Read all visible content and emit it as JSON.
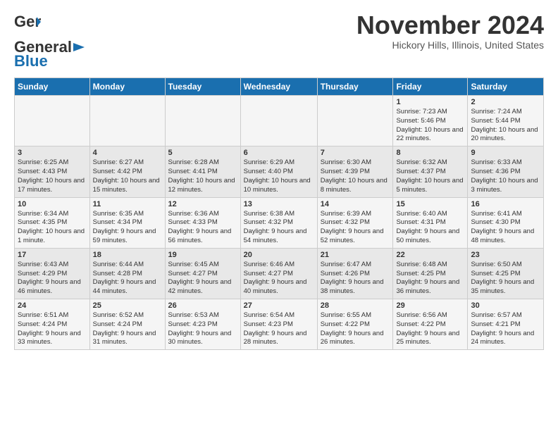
{
  "header": {
    "logo_general": "General",
    "logo_blue": "Blue",
    "month_title": "November 2024",
    "location": "Hickory Hills, Illinois, United States"
  },
  "days_of_week": [
    "Sunday",
    "Monday",
    "Tuesday",
    "Wednesday",
    "Thursday",
    "Friday",
    "Saturday"
  ],
  "weeks": [
    [
      {
        "day": "",
        "info": ""
      },
      {
        "day": "",
        "info": ""
      },
      {
        "day": "",
        "info": ""
      },
      {
        "day": "",
        "info": ""
      },
      {
        "day": "",
        "info": ""
      },
      {
        "day": "1",
        "info": "Sunrise: 7:23 AM\nSunset: 5:46 PM\nDaylight: 10 hours and 22 minutes."
      },
      {
        "day": "2",
        "info": "Sunrise: 7:24 AM\nSunset: 5:44 PM\nDaylight: 10 hours and 20 minutes."
      }
    ],
    [
      {
        "day": "3",
        "info": "Sunrise: 6:25 AM\nSunset: 4:43 PM\nDaylight: 10 hours and 17 minutes."
      },
      {
        "day": "4",
        "info": "Sunrise: 6:27 AM\nSunset: 4:42 PM\nDaylight: 10 hours and 15 minutes."
      },
      {
        "day": "5",
        "info": "Sunrise: 6:28 AM\nSunset: 4:41 PM\nDaylight: 10 hours and 12 minutes."
      },
      {
        "day": "6",
        "info": "Sunrise: 6:29 AM\nSunset: 4:40 PM\nDaylight: 10 hours and 10 minutes."
      },
      {
        "day": "7",
        "info": "Sunrise: 6:30 AM\nSunset: 4:39 PM\nDaylight: 10 hours and 8 minutes."
      },
      {
        "day": "8",
        "info": "Sunrise: 6:32 AM\nSunset: 4:37 PM\nDaylight: 10 hours and 5 minutes."
      },
      {
        "day": "9",
        "info": "Sunrise: 6:33 AM\nSunset: 4:36 PM\nDaylight: 10 hours and 3 minutes."
      }
    ],
    [
      {
        "day": "10",
        "info": "Sunrise: 6:34 AM\nSunset: 4:35 PM\nDaylight: 10 hours and 1 minute."
      },
      {
        "day": "11",
        "info": "Sunrise: 6:35 AM\nSunset: 4:34 PM\nDaylight: 9 hours and 59 minutes."
      },
      {
        "day": "12",
        "info": "Sunrise: 6:36 AM\nSunset: 4:33 PM\nDaylight: 9 hours and 56 minutes."
      },
      {
        "day": "13",
        "info": "Sunrise: 6:38 AM\nSunset: 4:32 PM\nDaylight: 9 hours and 54 minutes."
      },
      {
        "day": "14",
        "info": "Sunrise: 6:39 AM\nSunset: 4:32 PM\nDaylight: 9 hours and 52 minutes."
      },
      {
        "day": "15",
        "info": "Sunrise: 6:40 AM\nSunset: 4:31 PM\nDaylight: 9 hours and 50 minutes."
      },
      {
        "day": "16",
        "info": "Sunrise: 6:41 AM\nSunset: 4:30 PM\nDaylight: 9 hours and 48 minutes."
      }
    ],
    [
      {
        "day": "17",
        "info": "Sunrise: 6:43 AM\nSunset: 4:29 PM\nDaylight: 9 hours and 46 minutes."
      },
      {
        "day": "18",
        "info": "Sunrise: 6:44 AM\nSunset: 4:28 PM\nDaylight: 9 hours and 44 minutes."
      },
      {
        "day": "19",
        "info": "Sunrise: 6:45 AM\nSunset: 4:27 PM\nDaylight: 9 hours and 42 minutes."
      },
      {
        "day": "20",
        "info": "Sunrise: 6:46 AM\nSunset: 4:27 PM\nDaylight: 9 hours and 40 minutes."
      },
      {
        "day": "21",
        "info": "Sunrise: 6:47 AM\nSunset: 4:26 PM\nDaylight: 9 hours and 38 minutes."
      },
      {
        "day": "22",
        "info": "Sunrise: 6:48 AM\nSunset: 4:25 PM\nDaylight: 9 hours and 36 minutes."
      },
      {
        "day": "23",
        "info": "Sunrise: 6:50 AM\nSunset: 4:25 PM\nDaylight: 9 hours and 35 minutes."
      }
    ],
    [
      {
        "day": "24",
        "info": "Sunrise: 6:51 AM\nSunset: 4:24 PM\nDaylight: 9 hours and 33 minutes."
      },
      {
        "day": "25",
        "info": "Sunrise: 6:52 AM\nSunset: 4:24 PM\nDaylight: 9 hours and 31 minutes."
      },
      {
        "day": "26",
        "info": "Sunrise: 6:53 AM\nSunset: 4:23 PM\nDaylight: 9 hours and 30 minutes."
      },
      {
        "day": "27",
        "info": "Sunrise: 6:54 AM\nSunset: 4:23 PM\nDaylight: 9 hours and 28 minutes."
      },
      {
        "day": "28",
        "info": "Sunrise: 6:55 AM\nSunset: 4:22 PM\nDaylight: 9 hours and 26 minutes."
      },
      {
        "day": "29",
        "info": "Sunrise: 6:56 AM\nSunset: 4:22 PM\nDaylight: 9 hours and 25 minutes."
      },
      {
        "day": "30",
        "info": "Sunrise: 6:57 AM\nSunset: 4:21 PM\nDaylight: 9 hours and 24 minutes."
      }
    ]
  ]
}
